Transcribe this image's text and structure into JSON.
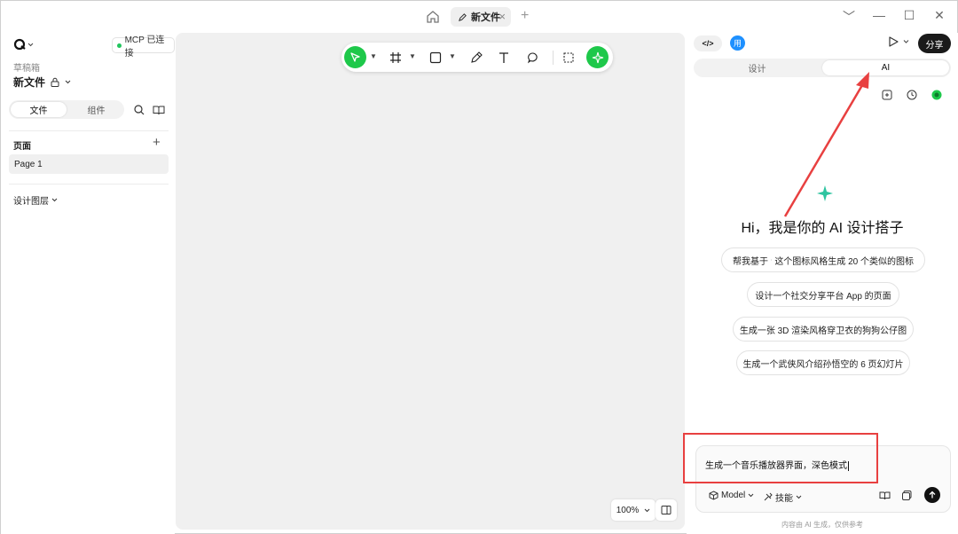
{
  "titlebar": {
    "tab_title": "新文件",
    "close_glyph": "×",
    "new_tab_glyph": "+",
    "window_controls": [
      "﹀",
      "—",
      "☐",
      "✕"
    ]
  },
  "sidebar": {
    "mcp_status": "MCP 已连接",
    "drafts_label": "草稿箱",
    "file_name": "新文件",
    "tabs": [
      {
        "label": "文件",
        "active": true
      },
      {
        "label": "组件",
        "active": false
      }
    ],
    "pages_header": "页面",
    "pages": [
      "Page 1"
    ],
    "layers_header": "设计图层"
  },
  "canvas": {
    "zoom": "100%"
  },
  "right_panel": {
    "code_label": "</>",
    "avatar_text": "用",
    "share_label": "分享",
    "tabs": [
      {
        "label": "设计",
        "active": false
      },
      {
        "label": "AI",
        "active": true
      }
    ],
    "greeting": "Hi，我是你的 AI 设计搭子",
    "suggestions": [
      {
        "prefix": "帮我基于",
        "suffix": "这个图标风格生成 20 个类似的图标"
      },
      {
        "text": "设计一个社交分享平台 App 的页面"
      },
      {
        "text": "生成一张 3D 渲染风格穿卫衣的狗狗公仔图"
      },
      {
        "text": "生成一个武侠风介绍孙悟空的 6 页幻灯片"
      }
    ],
    "chat_input": "生成一个音乐播放器界面，深色模式",
    "model_label": "Model",
    "skills_label": "技能",
    "disclaimer": "内容由 AI 生成，仅供参考"
  },
  "colors": {
    "accent_green": "#1ec84a",
    "annotation_red": "#e84040",
    "avatar_blue": "#1e90ff"
  }
}
